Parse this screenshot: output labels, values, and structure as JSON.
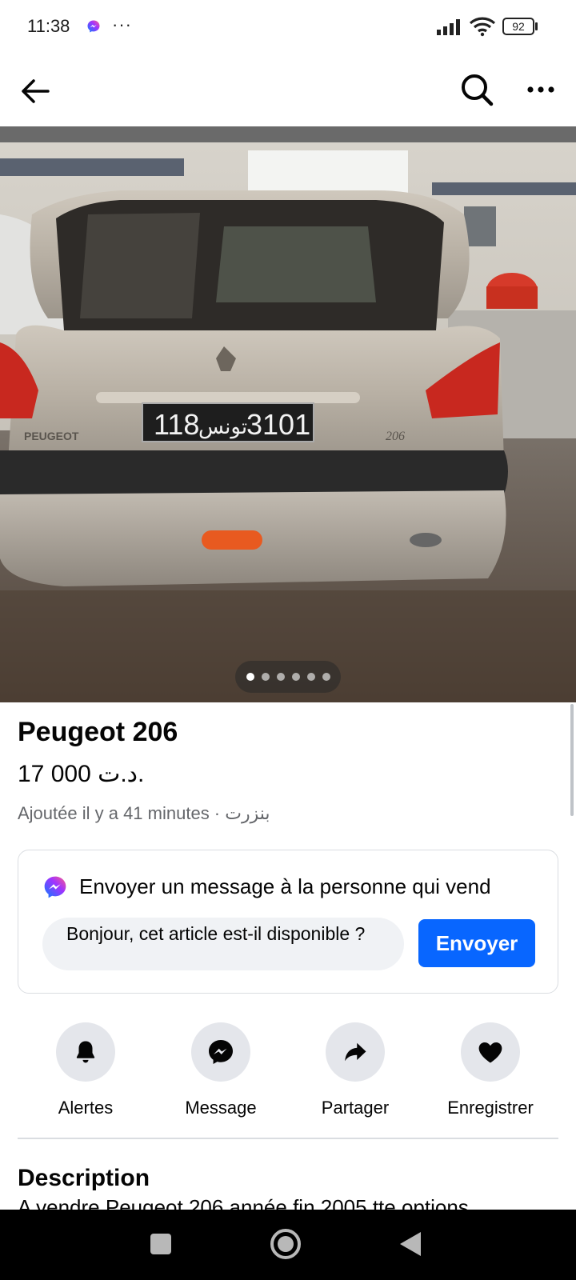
{
  "status_bar": {
    "time": "11:38",
    "overflow": "···",
    "battery": "92",
    "icons": [
      "messenger-icon",
      "signal-icon",
      "wifi-icon",
      "battery-icon"
    ]
  },
  "app_bar": {
    "icons": [
      "back-arrow-icon",
      "search-icon",
      "more-icon"
    ]
  },
  "photo": {
    "plate_left": "118",
    "plate_arabic": "تونس",
    "plate_right": "3101",
    "badge_brand": "PEUGEOT",
    "badge_model": "206",
    "page_count": 6,
    "active_page": 1
  },
  "listing": {
    "title": "Peugeot 206",
    "price": "17 000 د.ت.",
    "meta": "Ajoutée il y a 41 minutes · بنزرت"
  },
  "message_card": {
    "title": "Envoyer un message à la personne qui vend",
    "input_value": "Bonjour, cet article est-il disponible ?",
    "send_label": "Envoyer"
  },
  "actions": [
    {
      "label": "Alertes",
      "icon": "bell-icon"
    },
    {
      "label": "Message",
      "icon": "messenger-icon"
    },
    {
      "label": "Partager",
      "icon": "share-icon"
    },
    {
      "label": "Enregistrer",
      "icon": "heart-icon"
    }
  ],
  "description": {
    "heading": "Description",
    "text": "A vendre Peugeot 206 année fin 2005 tte options"
  },
  "nav_bar": {
    "icons": [
      "recents-icon",
      "home-icon",
      "back-icon"
    ]
  },
  "colors": {
    "accent": "#0866ff",
    "secondary_text": "#65676b",
    "chip_bg": "#e4e6eb",
    "input_bg": "#f0f2f5"
  }
}
